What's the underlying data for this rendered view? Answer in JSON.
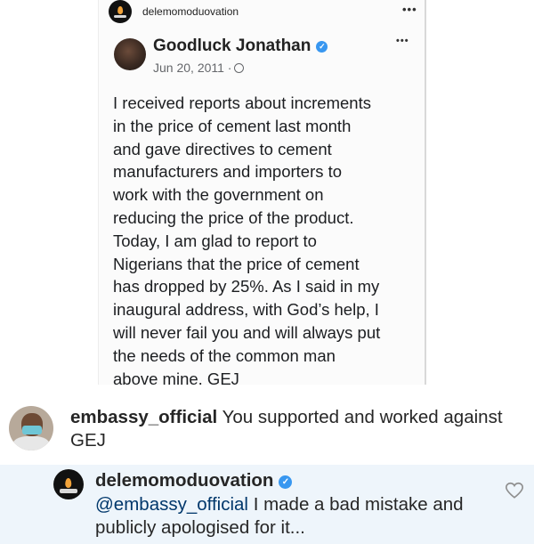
{
  "post_header": {
    "username": "delemomoduovation",
    "more_icon": "more-horizontal-icon"
  },
  "fb_post": {
    "author": "Goodluck Jonathan",
    "date": "Jun 20, 2011 ·",
    "more_icon": "more-horizontal-icon",
    "text": "I received reports about increments\nin the price of cement last month\nand gave directives to cement\nmanufacturers and importers to\nwork with the government on\nreducing the price of the product.\nToday, I am glad to report to\nNigerians that the price of cement\nhas dropped by 25%. As I said in my\ninaugural address, with God’s help, I\nwill never fail you and will always put\nthe needs of the common man\nabove mine. GEJ"
  },
  "comment": {
    "username": "embassy_official",
    "text": "You supported and worked against GEJ"
  },
  "reply": {
    "username": "delemomoduovation",
    "mention": "@embassy_official",
    "text": "I made a bad mistake and publicly apologised for it...",
    "like_icon": "heart-icon"
  },
  "colors": {
    "verified": "#3897f0",
    "reply_background": "#eef5fb",
    "mention": "#00376b"
  }
}
